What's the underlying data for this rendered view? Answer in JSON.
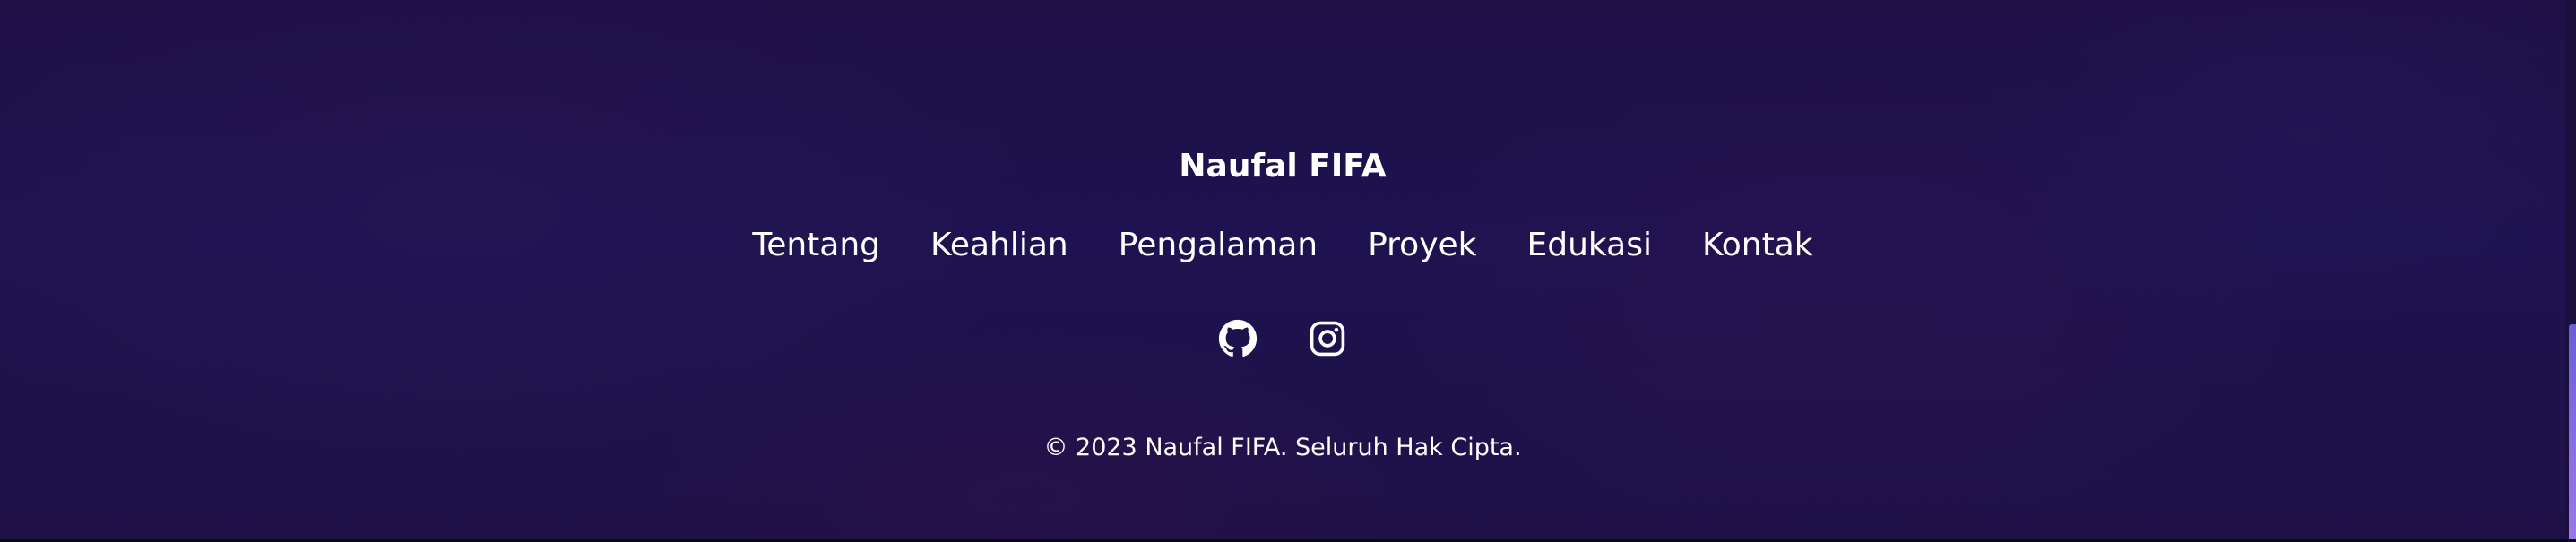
{
  "footer": {
    "brand": "Naufal FIFA",
    "nav": [
      {
        "label": "Tentang"
      },
      {
        "label": "Keahlian"
      },
      {
        "label": "Pengalaman"
      },
      {
        "label": "Proyek"
      },
      {
        "label": "Edukasi"
      },
      {
        "label": "Kontak"
      }
    ],
    "socials": [
      {
        "icon": "github-icon"
      },
      {
        "icon": "instagram-icon"
      }
    ],
    "copyright": "© 2023 Naufal FIFA. Seluruh Hak Cipta."
  },
  "colors": {
    "background": "#1e1246",
    "text": "#ffffff",
    "scrollbar_thumb": "#7b67e0"
  }
}
